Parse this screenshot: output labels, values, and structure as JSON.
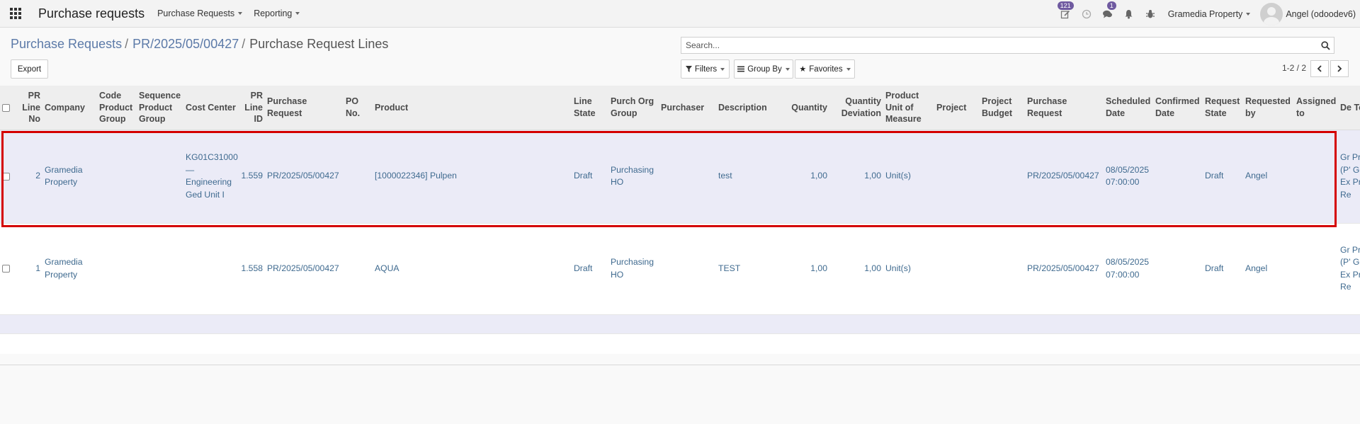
{
  "navbar": {
    "app_title": "Purchase requests",
    "menu_purchase_requests": "Purchase Requests",
    "menu_reporting": "Reporting",
    "activity_badge": "121",
    "messages_badge": "1",
    "company": "Gramedia Property",
    "user": "Angel (odoodev6)"
  },
  "breadcrumb": {
    "item1": "Purchase Requests",
    "item2": "PR/2025/05/00427",
    "current": "Purchase Request Lines"
  },
  "search": {
    "placeholder": "Search..."
  },
  "buttons": {
    "export": "Export",
    "filters": "Filters",
    "group_by": "Group By",
    "favorites": "Favorites"
  },
  "pager": {
    "value": "1-2 / 2"
  },
  "columns": {
    "pr_line_no": "PR Line No",
    "company": "Company",
    "code_product_group": "Code Product Group",
    "sequence_product_group": "Sequence Product Group",
    "cost_center": "Cost Center",
    "pr_line_id": "PR Line ID",
    "purchase_request": "Purchase Request",
    "po_no": "PO No.",
    "product": "Product",
    "line_state": "Line State",
    "purch_org_group": "Purch Org Group",
    "purchaser": "Purchaser",
    "description": "Description",
    "quantity": "Quantity",
    "quantity_deviation": "Quantity Deviation",
    "product_uom": "Product Unit of Measure",
    "project": "Project",
    "project_budget": "Project Budget",
    "purchase_request_2": "Purchase Request",
    "scheduled_date": "Scheduled Date",
    "confirmed_date": "Confirmed Date",
    "request_state": "Request State",
    "requested_by": "Requested by",
    "assigned_to": "Assigned to",
    "delivery_to": "De To"
  },
  "rows": [
    {
      "pr_line_no": "2",
      "company": "Gramedia Property",
      "code_product_group": "",
      "sequence_product_group": "",
      "cost_center": "KG01C31000 — Engineering Ged Unit I",
      "pr_line_id": "1.559",
      "purchase_request": "PR/2025/05/00427",
      "po_no": "",
      "product": "[1000022346] Pulpen",
      "line_state": "Draft",
      "purch_org_group": "Purchasing HO",
      "purchaser": "",
      "description": "test",
      "quantity": "1,00",
      "quantity_deviation": "1,00",
      "product_uom": "Unit(s)",
      "project": "",
      "project_budget": "",
      "purchase_request_2": "PR/2025/05/00427",
      "scheduled_date": "08/05/2025 07:00:00",
      "confirmed_date": "",
      "request_state": "Draft",
      "requested_by": "Angel",
      "assigned_to": "",
      "delivery_to": "Gr Pr (P' Gr Ex Pr Re"
    },
    {
      "pr_line_no": "1",
      "company": "Gramedia Property",
      "code_product_group": "",
      "sequence_product_group": "",
      "cost_center": "",
      "pr_line_id": "1.558",
      "purchase_request": "PR/2025/05/00427",
      "po_no": "",
      "product": "AQUA",
      "line_state": "Draft",
      "purch_org_group": "Purchasing HO",
      "purchaser": "",
      "description": "TEST",
      "quantity": "1,00",
      "quantity_deviation": "1,00",
      "product_uom": "Unit(s)",
      "project": "",
      "project_budget": "",
      "purchase_request_2": "PR/2025/05/00427",
      "scheduled_date": "08/05/2025 07:00:00",
      "confirmed_date": "",
      "request_state": "Draft",
      "requested_by": "Angel",
      "assigned_to": "",
      "delivery_to": "Gr Pr (P' Gr Ex Pr Re"
    }
  ],
  "colors": {
    "link": "#3f6a8f",
    "breadcrumb": "#5c7aa8",
    "selected_row": "#ebebf7",
    "highlight": "#d40000",
    "badge": "#6f5aa0"
  }
}
